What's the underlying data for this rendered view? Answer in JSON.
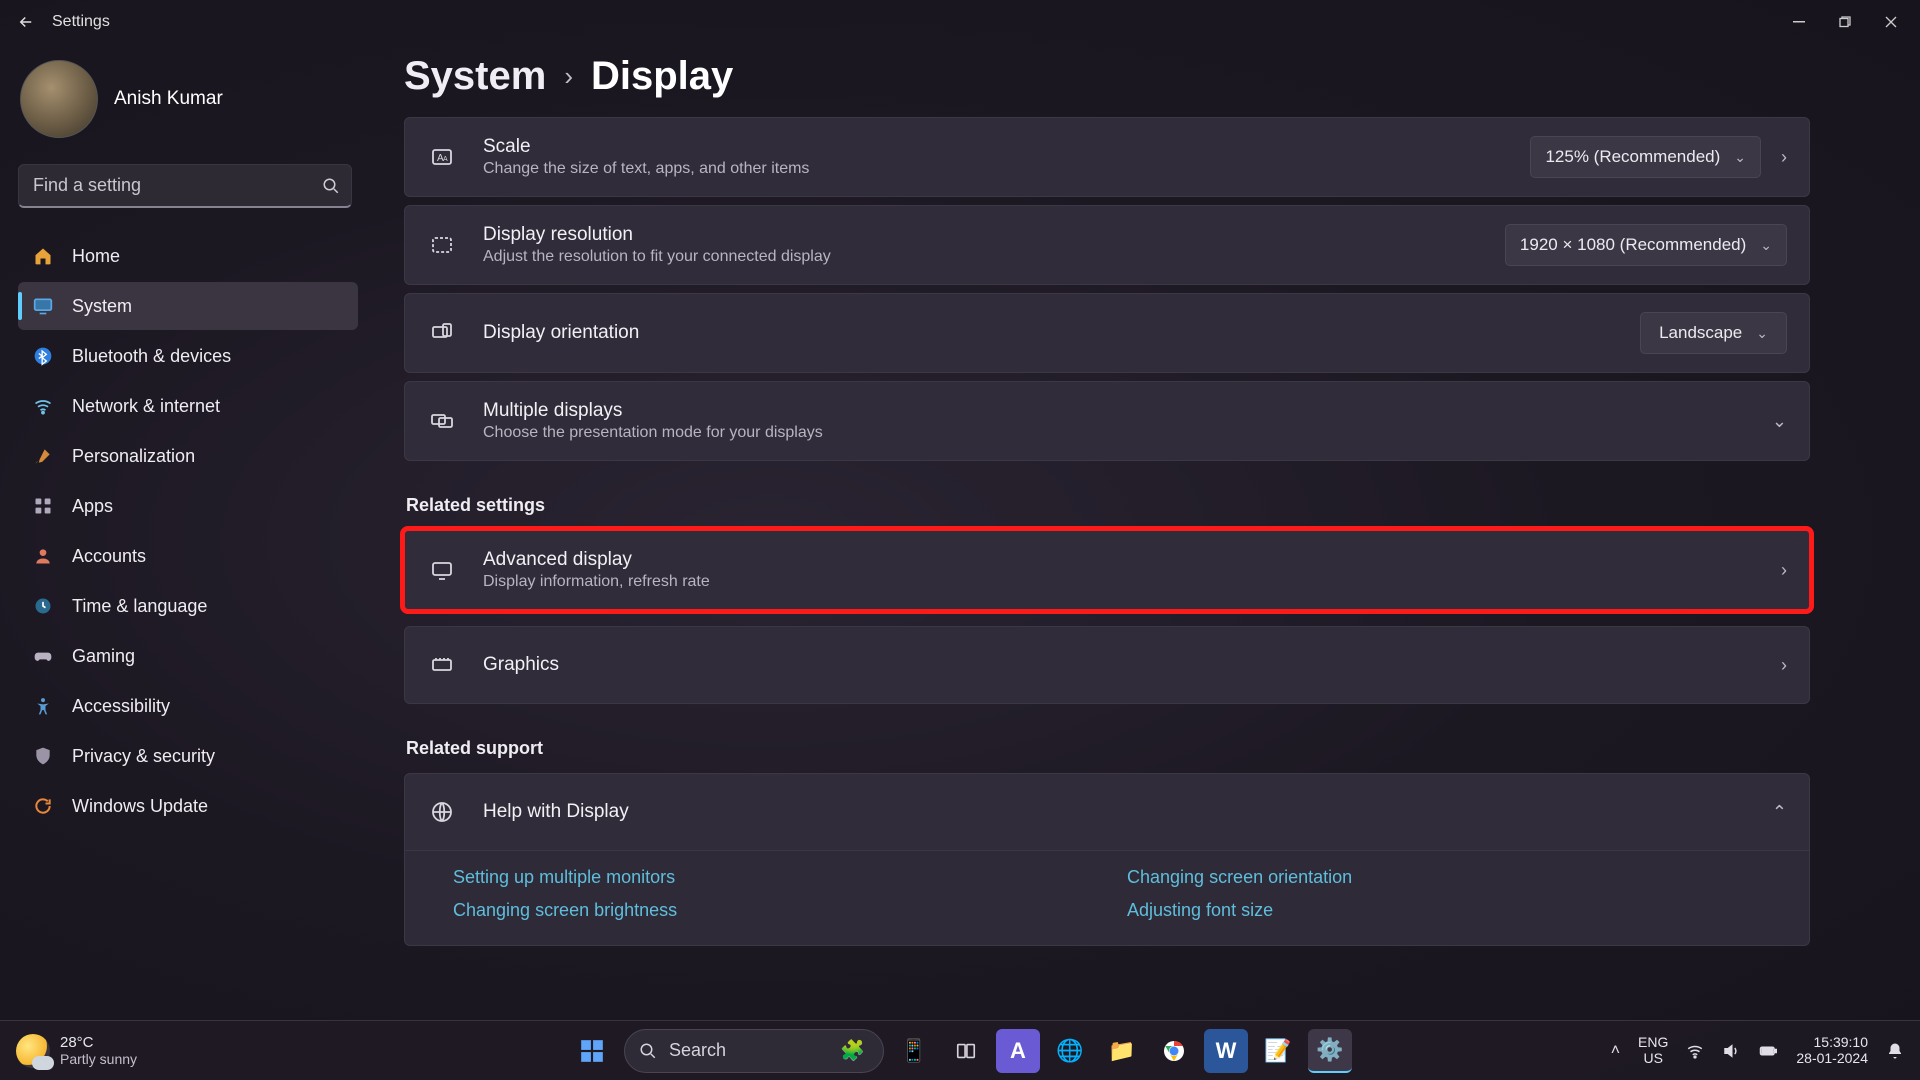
{
  "window": {
    "title": "Settings"
  },
  "profile": {
    "name": "Anish Kumar"
  },
  "search": {
    "placeholder": "Find a setting"
  },
  "sidebar": {
    "items": [
      {
        "icon": "home",
        "label": "Home"
      },
      {
        "icon": "system",
        "label": "System"
      },
      {
        "icon": "bluetooth",
        "label": "Bluetooth & devices"
      },
      {
        "icon": "wifi",
        "label": "Network & internet"
      },
      {
        "icon": "personalization",
        "label": "Personalization"
      },
      {
        "icon": "apps",
        "label": "Apps"
      },
      {
        "icon": "accounts",
        "label": "Accounts"
      },
      {
        "icon": "time",
        "label": "Time & language"
      },
      {
        "icon": "gaming",
        "label": "Gaming"
      },
      {
        "icon": "accessibility",
        "label": "Accessibility"
      },
      {
        "icon": "privacy",
        "label": "Privacy & security"
      },
      {
        "icon": "update",
        "label": "Windows Update"
      }
    ],
    "active_index": 1
  },
  "breadcrumb": {
    "parent": "System",
    "current": "Display"
  },
  "settings": {
    "scale": {
      "title": "Scale",
      "subtitle": "Change the size of text, apps, and other items",
      "value": "125% (Recommended)"
    },
    "resolution": {
      "title": "Display resolution",
      "subtitle": "Adjust the resolution to fit your connected display",
      "value": "1920 × 1080 (Recommended)"
    },
    "orientation": {
      "title": "Display orientation",
      "value": "Landscape"
    },
    "multiple": {
      "title": "Multiple displays",
      "subtitle": "Choose the presentation mode for your displays"
    }
  },
  "related_settings_header": "Related settings",
  "related": {
    "advanced": {
      "title": "Advanced display",
      "subtitle": "Display information, refresh rate"
    },
    "graphics": {
      "title": "Graphics"
    }
  },
  "related_support_header": "Related support",
  "help": {
    "title": "Help with Display",
    "links": [
      "Setting up multiple monitors",
      "Changing screen orientation",
      "Changing screen brightness",
      "Adjusting font size"
    ]
  },
  "taskbar": {
    "weather": {
      "temp": "28°C",
      "desc": "Partly sunny"
    },
    "search_placeholder": "Search",
    "lang": {
      "top": "ENG",
      "bottom": "US"
    },
    "clock": {
      "time": "15:39:10",
      "date": "28-01-2024"
    }
  }
}
